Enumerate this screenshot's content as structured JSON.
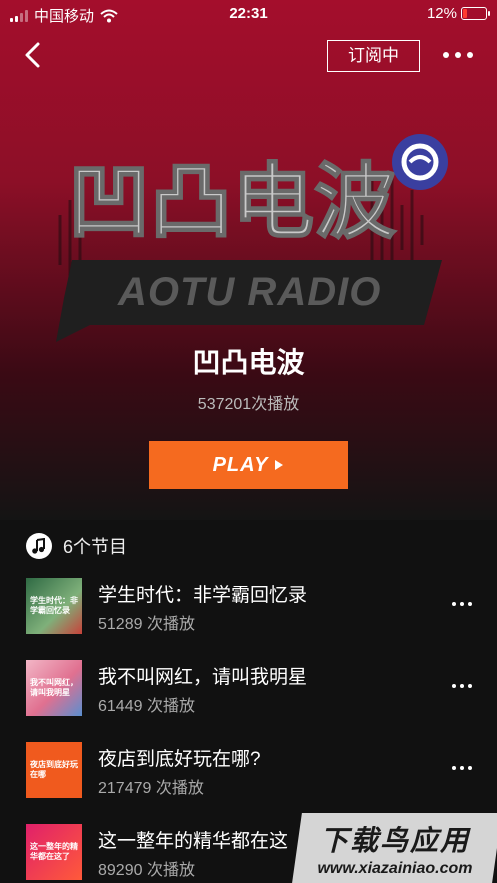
{
  "status": {
    "carrier": "中国移动",
    "time": "22:31",
    "battery": "12%"
  },
  "header": {
    "subscribe_label": "订阅中"
  },
  "cover": {
    "logo_text": "凹凸电波",
    "logo_subtitle": "AOTU RADIO"
  },
  "podcast": {
    "title": "凹凸电波",
    "play_count": "537201次播放",
    "play_label": "PLAY"
  },
  "episodes_header": {
    "count_label": "6个节目"
  },
  "episodes": [
    {
      "title": "学生时代：非学霸回忆录",
      "plays": "51289 次播放",
      "thumb_text": "学生时代：非学霸回忆录",
      "thumb_color": "#4a8a5a"
    },
    {
      "title": "我不叫网红，请叫我明星",
      "plays": "61449 次播放",
      "thumb_text": "我不叫网红，请叫我明星",
      "thumb_color": "#e8a9b8"
    },
    {
      "title": "夜店到底好玩在哪?",
      "plays": "217479 次播放",
      "thumb_text": "夜店到底好玩在哪",
      "thumb_color": "#f05a1e"
    },
    {
      "title": "这一整年的精华都在这",
      "plays": "89290 次播放",
      "thumb_text": "这一整年的精华都在这了",
      "thumb_color": "#e0206a"
    }
  ],
  "watermark": {
    "title": "下载鸟应用",
    "url": "www.xiazainiao.com"
  },
  "colors": {
    "hero_red": "#a40e2c",
    "play_orange": "#f56a1f",
    "background": "#111111"
  }
}
